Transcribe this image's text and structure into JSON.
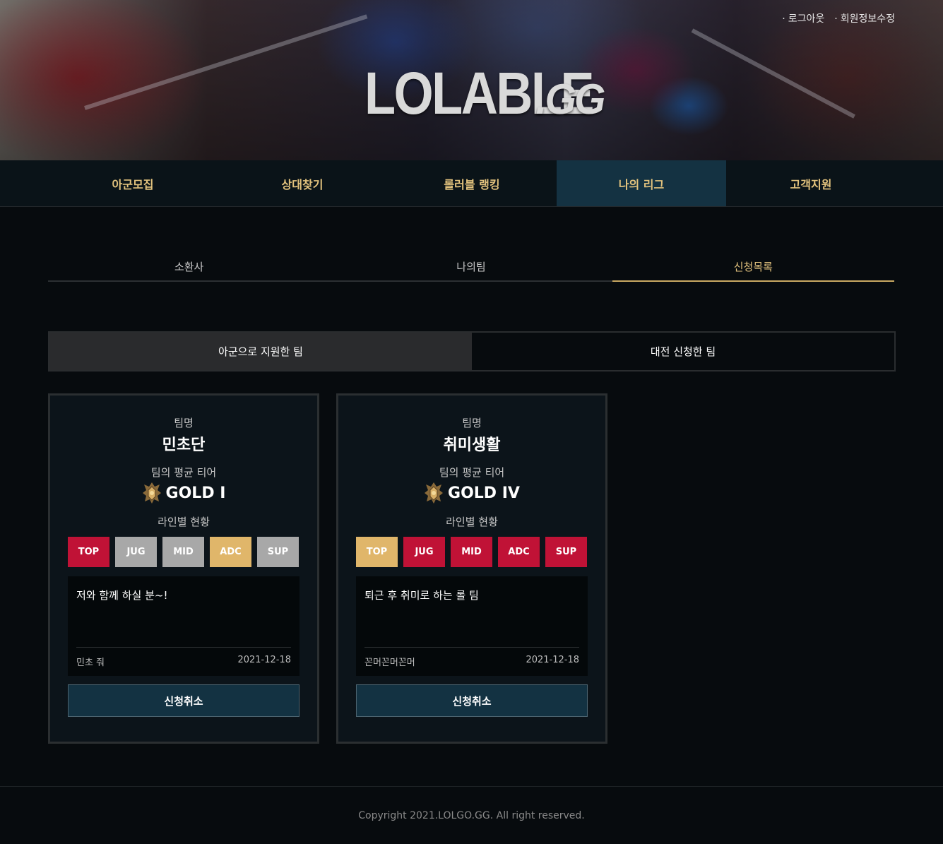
{
  "header": {
    "logo_main": "LOLABLE",
    "logo_suffix": ".GG",
    "links": [
      {
        "label": "로그아웃"
      },
      {
        "label": "회원정보수정"
      }
    ],
    "link_bullet": "·"
  },
  "nav": {
    "items": [
      {
        "label": "아군모집"
      },
      {
        "label": "상대찾기"
      },
      {
        "label": "롤러블 랭킹"
      },
      {
        "label": "나의 리그",
        "active": true
      },
      {
        "label": "고객지원"
      }
    ]
  },
  "subtabs": {
    "items": [
      {
        "label": "소환사"
      },
      {
        "label": "나의팀"
      },
      {
        "label": "신청목록",
        "active": true
      }
    ]
  },
  "toggle": {
    "options": [
      {
        "label": "아군으로 지원한 팀",
        "active": true
      },
      {
        "label": "대전 신청한 팀"
      }
    ]
  },
  "cards": [
    {
      "team_label": "팀명",
      "team_name": "민초단",
      "tier_label": "팀의 평균 티어",
      "tier": "GOLD I",
      "lanes_label": "라인별 현황",
      "lanes": [
        {
          "name": "TOP",
          "state": "open"
        },
        {
          "name": "JUG",
          "state": "closed"
        },
        {
          "name": "MID",
          "state": "closed"
        },
        {
          "name": "ADC",
          "state": "mine"
        },
        {
          "name": "SUP",
          "state": "closed"
        }
      ],
      "message": "저와 함께 하실 분~!",
      "author": "민초 줘",
      "date": "2021-12-18",
      "cancel_label": "신청취소"
    },
    {
      "team_label": "팀명",
      "team_name": "취미생활",
      "tier_label": "팀의 평균 티어",
      "tier": "GOLD IV",
      "lanes_label": "라인별 현황",
      "lanes": [
        {
          "name": "TOP",
          "state": "mine"
        },
        {
          "name": "JUG",
          "state": "open"
        },
        {
          "name": "MID",
          "state": "open"
        },
        {
          "name": "ADC",
          "state": "open"
        },
        {
          "name": "SUP",
          "state": "open"
        }
      ],
      "message": "퇴근 후 취미로 하는 롤 팀",
      "author": "꼰머꼰머꼰머",
      "date": "2021-12-18",
      "cancel_label": "신청취소"
    }
  ],
  "colors": {
    "accent_gold": "#e2c27d",
    "nav_active": "#143242",
    "lane_open": "#c01236",
    "lane_closed": "#a8a8a8",
    "lane_mine": "#e0b66a"
  },
  "icons": {
    "tier_emblem": "gold-tier-emblem-icon"
  },
  "footer": {
    "copyright": "Copyright 2021.LOLGO.GG. All right reserved."
  }
}
